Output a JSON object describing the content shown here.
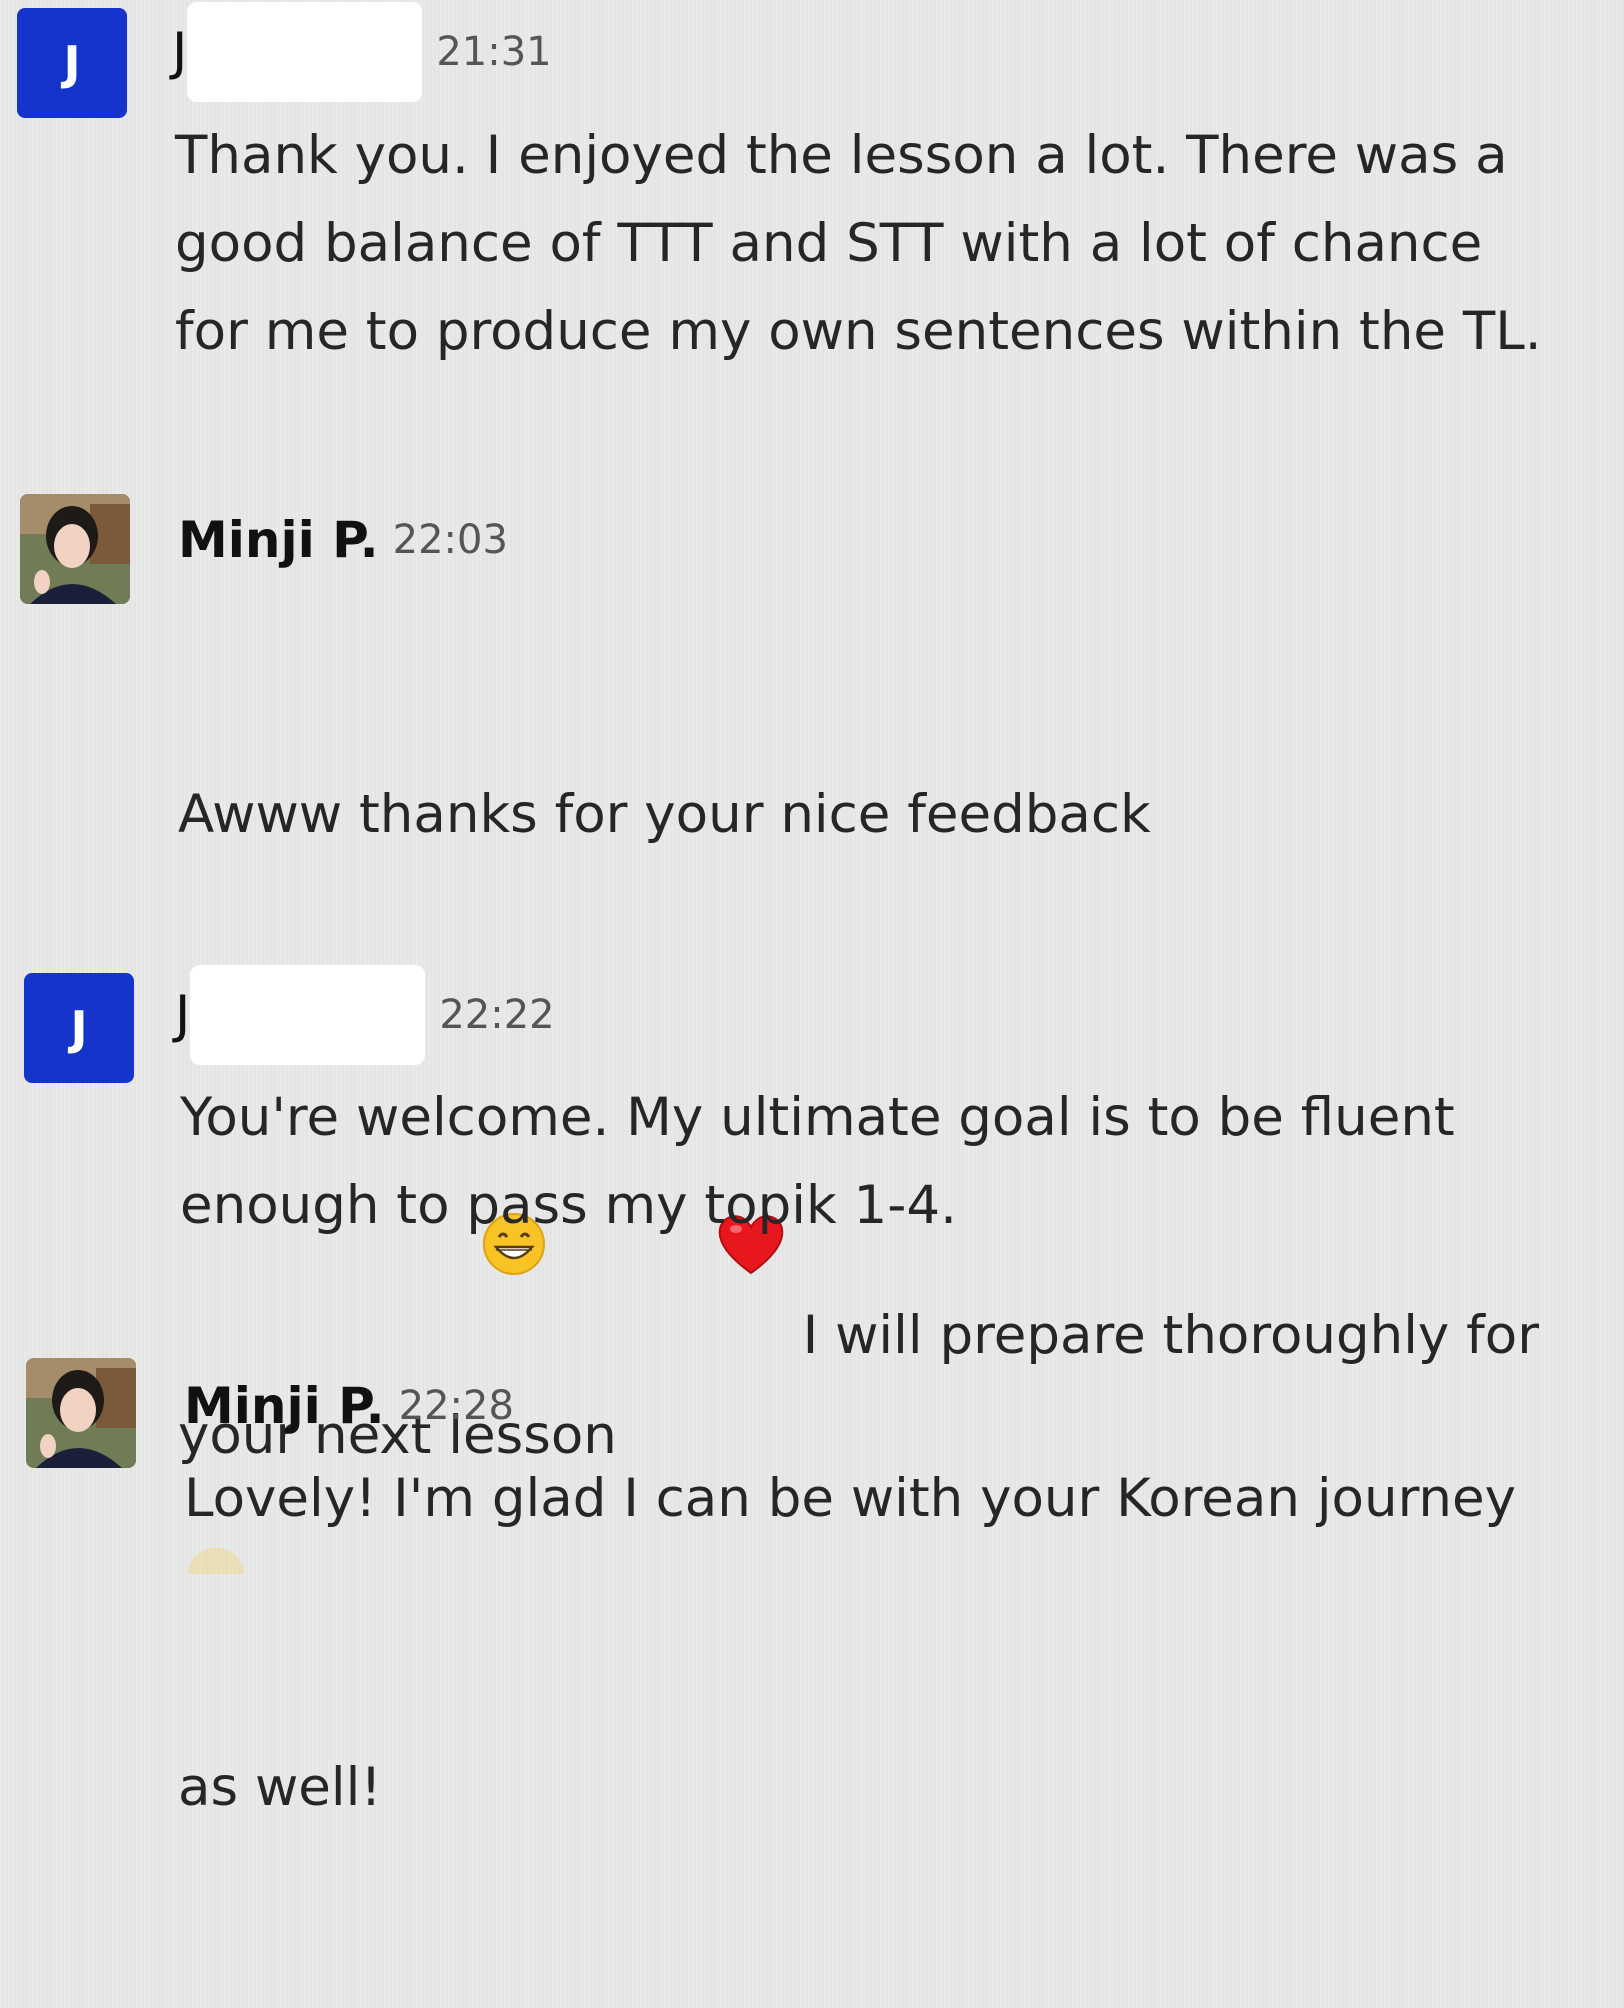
{
  "messages": [
    {
      "sender_initial": "J",
      "sender_visible": "J",
      "time": "21:31",
      "text": "Thank you. I enjoyed the lesson a lot. There was a\ngood balance of TTT and STT with a lot of chance\nfor me to produce my own sentences within the TL."
    },
    {
      "sender": "Minji P.",
      "time": "22:03",
      "line1": "Awww thanks for your nice feedback",
      "line2": "I will prepare thoroughly for your next lesson",
      "line3": "as well!",
      "emojis": [
        "grinning-face-emoji",
        "red-heart-emoji"
      ]
    },
    {
      "sender_initial": "J",
      "sender_visible": "J",
      "time": "22:22",
      "text": "You're welcome. My ultimate goal is to be fluent\nenough to pass my topik 1-4."
    },
    {
      "sender": "Minji P.",
      "time": "22:28",
      "text": "Lovely! I'm glad I can be with your Korean journey"
    }
  ],
  "colors": {
    "avatar_initial_bg": "#1434cb",
    "background": "#e7e8e7",
    "redaction": "#ffffff"
  }
}
